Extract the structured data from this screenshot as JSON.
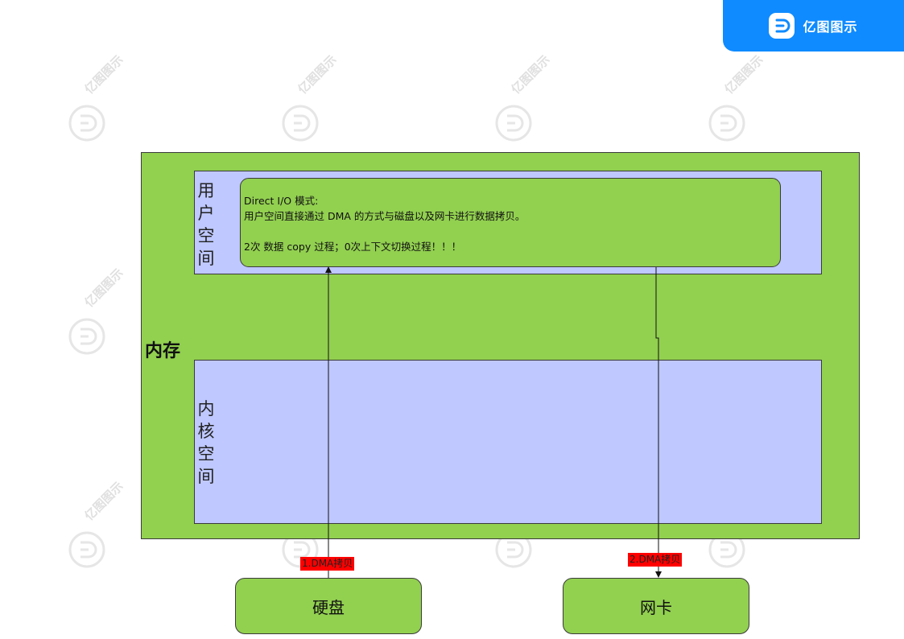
{
  "brand": {
    "name": "亿图图示",
    "accent": "#0f8bff"
  },
  "watermark": {
    "text": "亿图图示"
  },
  "diagram": {
    "memory_label": "内存",
    "user_space_label": [
      "用",
      "户",
      "空",
      "间"
    ],
    "kernel_space_label": [
      "内",
      "核",
      "空",
      "间"
    ],
    "note": {
      "line1": "Direct I/O 模式:",
      "line2": "用户空间直接通过 DMA 的方式与磁盘以及网卡进行数据拷贝。",
      "line3": "2次 数据 copy 过程；0次上下文切换过程！！！"
    },
    "disk": "硬盘",
    "nic": "网卡",
    "arrow1_label": "1.DMA拷贝",
    "arrow2_label": "2.DMA拷贝",
    "colors": {
      "container": "#92d050",
      "space": "#bfc8ff",
      "label_bg": "#ff0000"
    }
  }
}
